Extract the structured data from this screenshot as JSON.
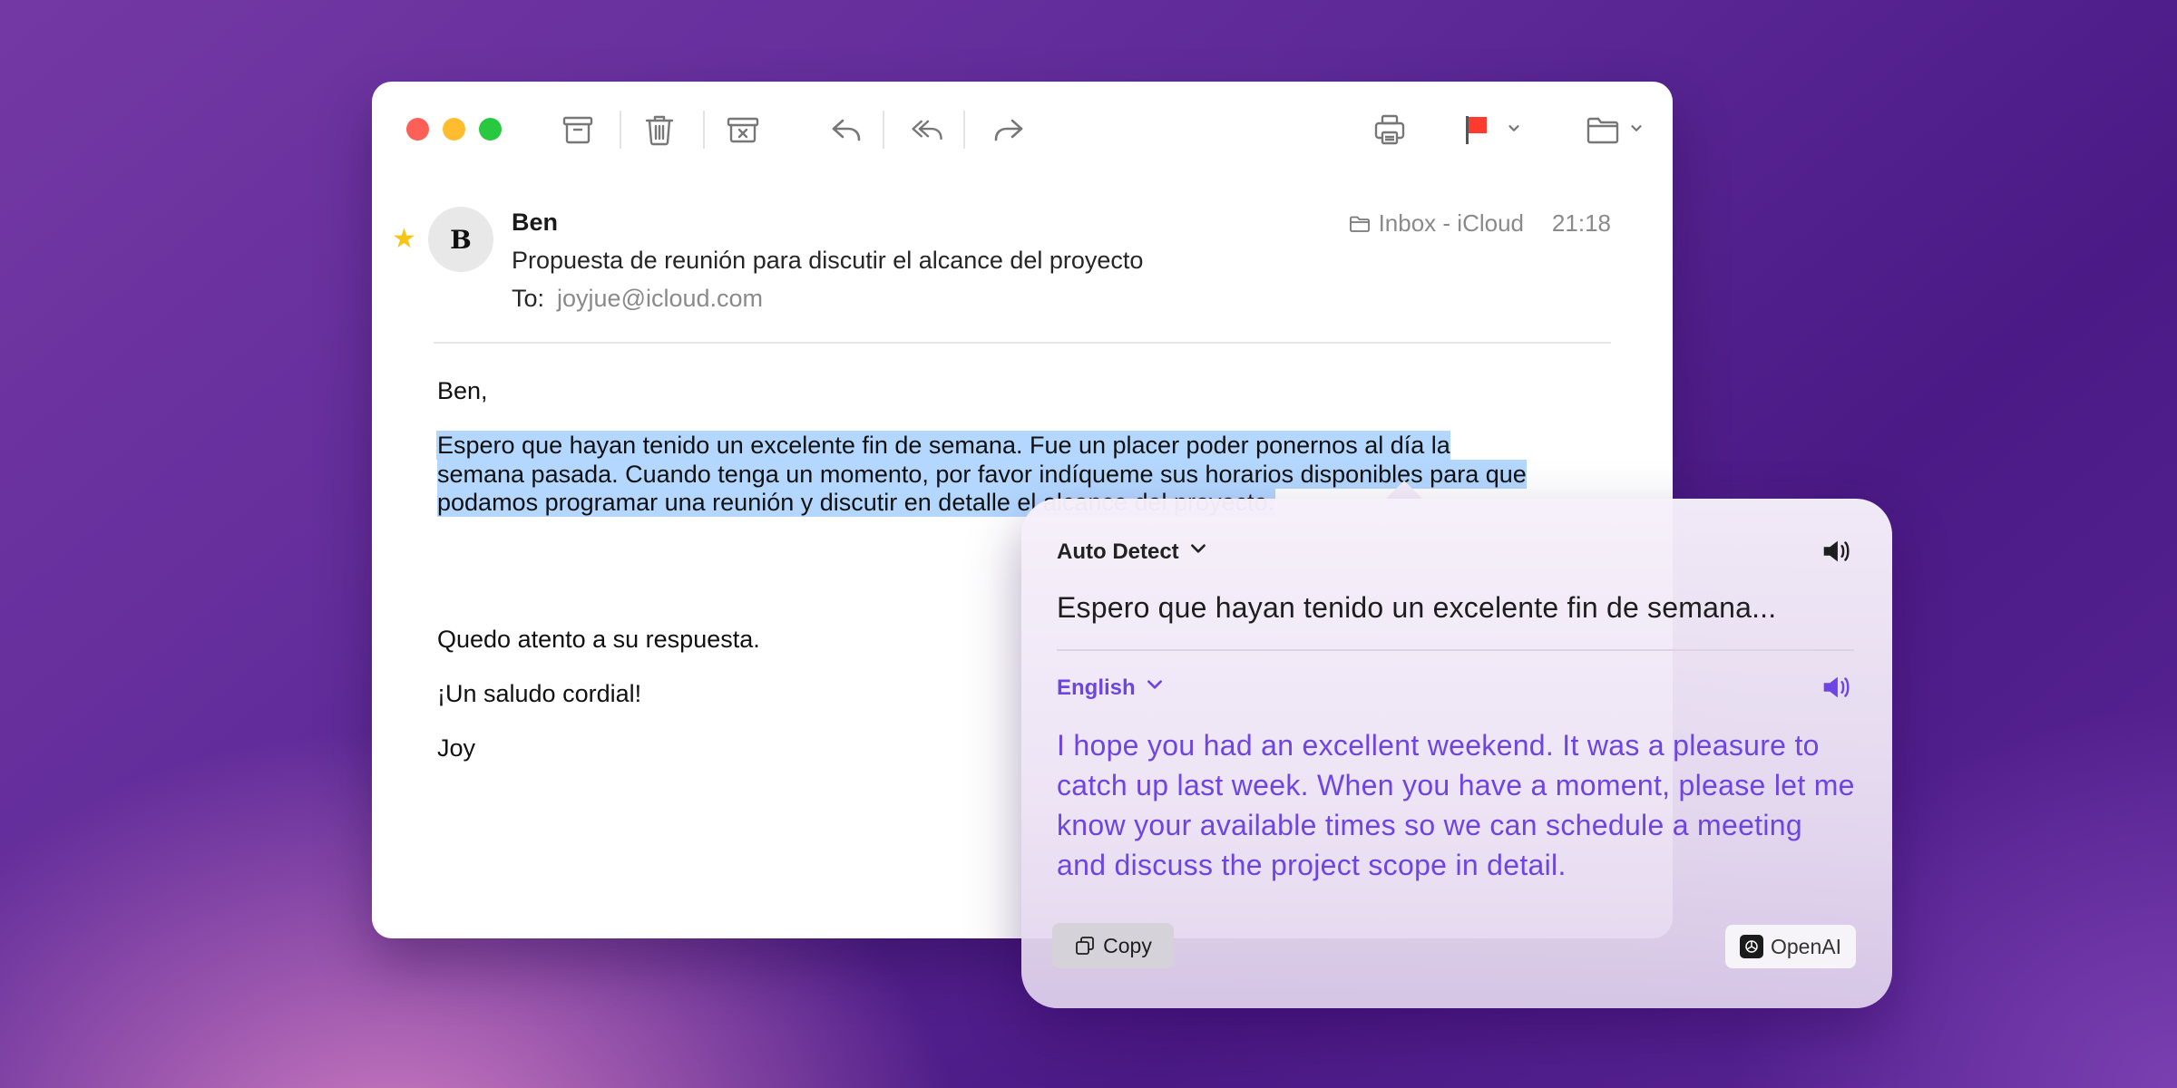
{
  "colors": {
    "accent": "#6e45e2",
    "selection": "#b3d7ff",
    "flag": "#ff3b30",
    "star": "#f5c518",
    "traffic_close": "#fe5f57",
    "traffic_min": "#febc2e",
    "traffic_max": "#28c840"
  },
  "toolbar": {
    "icons": [
      "archive-icon",
      "trash-icon",
      "junk-icon",
      "reply-icon",
      "reply-all-icon",
      "forward-icon",
      "print-icon",
      "flag-icon",
      "chevron-down-icon",
      "folder-icon",
      "chevron-down-icon"
    ]
  },
  "message": {
    "avatar_initial": "B",
    "sender": "Ben",
    "subject": "Propuesta de reunión para discutir el alcance del proyecto",
    "to_label": "To:",
    "to_address": "joyjue@icloud.com",
    "mailbox": "Inbox - iCloud",
    "time": "21:18",
    "body": {
      "greeting": "Ben,",
      "paragraph": "Espero que hayan tenido un excelente fin de semana. Fue un placer poder ponernos al día la semana pasada. Cuando tenga un momento, por favor indíqueme sus horarios disponibles para que podamos programar una reunión y discutir en detalle el alcance del proyecto.",
      "closing": "Quedo atento a su respuesta.",
      "salutation": "¡Un saludo cordial!",
      "signature": "Joy"
    }
  },
  "translator": {
    "source_language": "Auto Detect",
    "source_text": "Espero que hayan tenido un excelente fin de semana...",
    "target_language": "English",
    "target_text": "I hope you had an excellent weekend. It was a pleasure to catch up last week. When you have a moment, please let me know your available times so we can schedule a meeting and discuss the project scope in detail.",
    "copy_label": "Copy",
    "provider": "OpenAI"
  }
}
